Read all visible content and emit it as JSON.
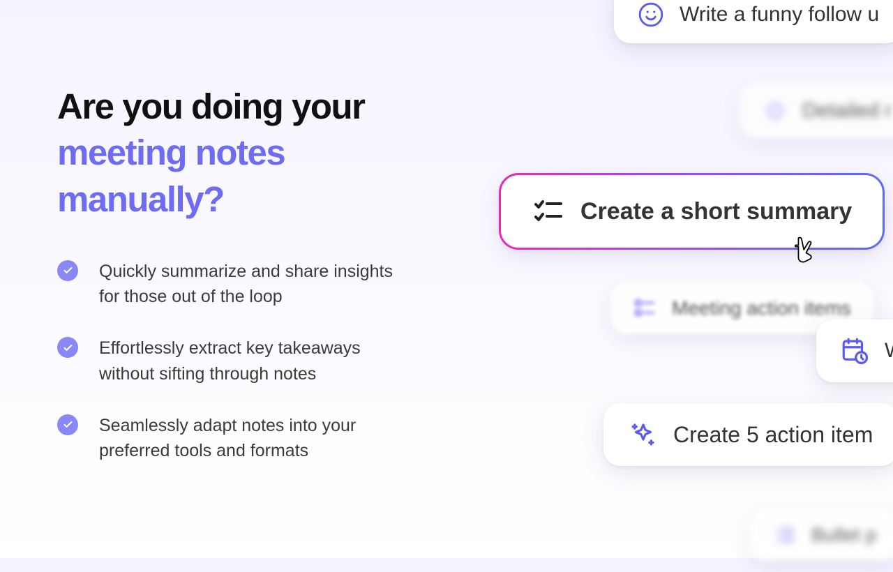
{
  "heading": {
    "line1": "Are you doing your",
    "line2_accent": "meeting notes manually?"
  },
  "bullets": [
    "Quickly summarize and share insights for those out of the loop",
    "Effortlessly extract key takeaways without sifting through notes",
    "Seamlessly adapt notes into your preferred tools and formats"
  ],
  "chips": {
    "funny_follow": "Write a funny follow u",
    "detailed": "Detailed r",
    "short_summary": "Create a short summary",
    "meeting_action": "Meeting action items",
    "calendar_partial": "W",
    "five_action": "Create 5 action item",
    "bullet_p": "Bullet p"
  },
  "colors": {
    "accent": "#6e6cf2",
    "check_bg": "#8a88f6"
  }
}
